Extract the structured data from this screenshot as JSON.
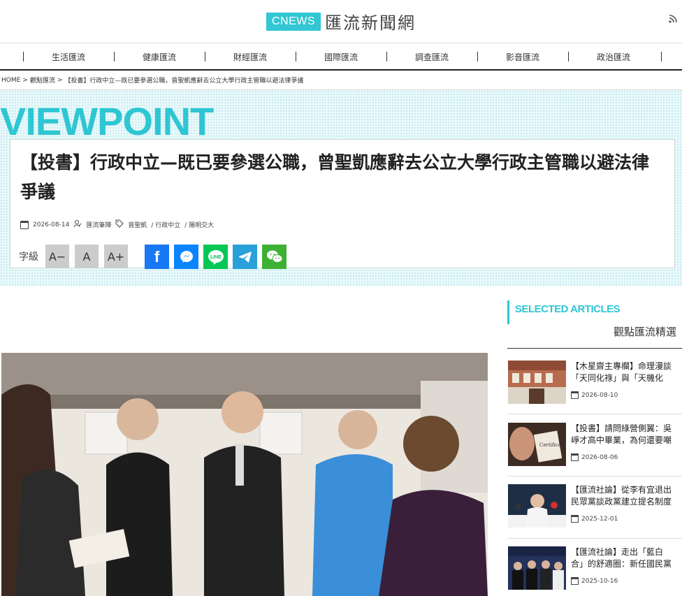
{
  "header": {
    "logo_badge": "CNEWS",
    "logo_text": "匯流新聞網"
  },
  "nav": {
    "items": [
      "生活匯流",
      "健康匯流",
      "財經匯流",
      "國際匯流",
      "調查匯流",
      "影音匯流",
      "政治匯流"
    ]
  },
  "breadcrumb": {
    "home": "HOME",
    "sep": ">",
    "section": "觀點匯流",
    "current": "【投書】行政中立—既已要參選公職，曾聖凱應辭去公立大學行政主管職以避法律爭議"
  },
  "viewpoint": {
    "brand": "VIEWPOINT"
  },
  "article": {
    "title": "【投書】行政中立—既已要參選公職，曾聖凱應辭去公立大學行政主管職以避法律爭議",
    "date": "2026-08-14",
    "author": "匯流筆陣",
    "tags": [
      "曾聖凱",
      "/ 行政中立",
      "/ 陽明交大"
    ],
    "font_label": "字級",
    "font_buttons": [
      "A−",
      "A",
      "A+"
    ]
  },
  "sidebar": {
    "heading_en": "SELECTED ARTICLES",
    "heading_zh": "觀點匯流精選",
    "items": [
      {
        "title1": "【木星齋主專欄】命理漫談",
        "title2": "「天同化祿」與「天機化",
        "date": "2026-08-10"
      },
      {
        "title1": "【投書】請問綠營側翼：吳",
        "title2": "崢才高中畢業，為何還要嘲",
        "date": "2026-08-06"
      },
      {
        "title1": "【匯流社論】從李有宜退出",
        "title2": "民眾黨談政黨建立提名制度",
        "date": "2025-12-01"
      },
      {
        "title1": "【匯流社論】走出「藍白",
        "title2": "合」的舒適圈：新任國民黨",
        "date": "2025-10-16"
      }
    ]
  },
  "colors": {
    "accent": "#2fc6d3",
    "facebook": "#1877f2",
    "messenger": "#0b84ff",
    "line": "#06c755",
    "telegram": "#2aa0d9",
    "wechat": "#3eb134"
  }
}
